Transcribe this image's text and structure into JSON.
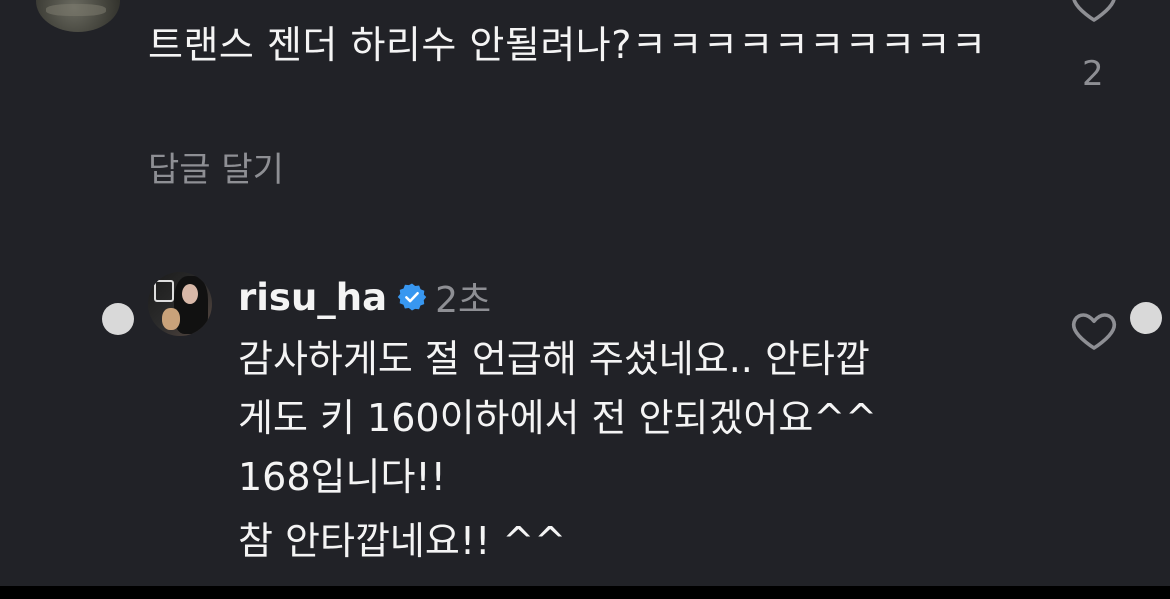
{
  "comment": {
    "text": "트랜스 젠더 하리수 안될려나?ㅋㅋㅋㅋㅋㅋㅋㅋㅋㅋ",
    "reply_label": "답글 달기",
    "likes": "2",
    "avatar_icon": "profile-photo"
  },
  "reply": {
    "username": "risu_ha",
    "time": "2초",
    "verified_icon": "verified-badge-icon",
    "verified_color": "#3897f0",
    "lines": [
      "감사하게도 절 언급해 주셨네요.. 안타깝",
      "게도 키 160이하에서 전 안되겠어요^^",
      "168입니다!!",
      "참 안타깝네요!! ^^"
    ]
  },
  "colors": {
    "background": "#212227",
    "text": "#f4f4f4",
    "muted": "#8e8f94",
    "dot": "#d9d9d9"
  }
}
